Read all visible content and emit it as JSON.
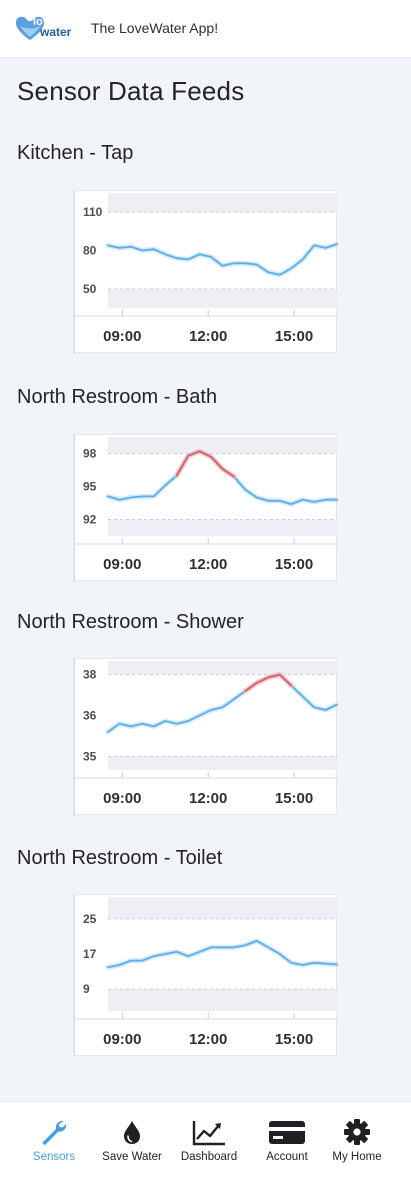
{
  "header": {
    "logo_text_line1": "love",
    "logo_text_line2": "water",
    "app_title": "The LoveWater App!"
  },
  "page_title": "Sensor Data Feeds",
  "colors": {
    "accent": "#4a9be8",
    "line": "#5aaee8",
    "alert_line": "#e05a63",
    "band": "#eeeef4"
  },
  "sensors": [
    {
      "title": "Kitchen - Tap",
      "chart_data": {
        "type": "line",
        "x_ticks": [
          "09:00",
          "12:00",
          "15:00"
        ],
        "y_ticks": [
          "110",
          "80",
          "50"
        ],
        "ylim": [
          35,
          125
        ],
        "normal_band": [
          50,
          110
        ],
        "x": [
          8.5,
          8.9,
          9.3,
          9.7,
          10.1,
          10.5,
          10.9,
          11.3,
          11.7,
          12.1,
          12.5,
          12.9,
          13.3,
          13.7,
          14.1,
          14.5,
          14.9,
          15.3,
          15.7,
          16.1,
          16.5
        ],
        "values": [
          84,
          82,
          83,
          80,
          81,
          77,
          74,
          73,
          77,
          75,
          68,
          70,
          70,
          69,
          63,
          61,
          66,
          73,
          84,
          82,
          85
        ],
        "alert_segments": []
      }
    },
    {
      "title": "North Restroom - Bath",
      "chart_data": {
        "type": "line",
        "x_ticks": [
          "09:00",
          "12:00",
          "15:00"
        ],
        "y_ticks": [
          "98",
          "95",
          "92"
        ],
        "ylim": [
          90.5,
          99.5
        ],
        "normal_band": [
          92,
          98
        ],
        "x": [
          8.5,
          8.9,
          9.3,
          9.7,
          10.1,
          10.5,
          10.9,
          11.3,
          11.7,
          12.1,
          12.5,
          12.9,
          13.3,
          13.7,
          14.1,
          14.5,
          14.9,
          15.3,
          15.7,
          16.1,
          16.5
        ],
        "values": [
          94.1,
          93.8,
          94.0,
          94.1,
          94.1,
          95.1,
          96.0,
          97.8,
          98.2,
          97.7,
          96.6,
          95.9,
          94.7,
          94.0,
          93.7,
          93.7,
          93.4,
          93.8,
          93.6,
          93.8,
          93.8
        ],
        "alert_segments": [
          [
            6,
            11
          ]
        ]
      }
    },
    {
      "title": "North Restroom - Shower",
      "chart_data": {
        "type": "line",
        "x_ticks": [
          "09:00",
          "12:00",
          "15:00"
        ],
        "y_ticks": [
          "38",
          "36",
          "35"
        ],
        "ylim": [
          34.5,
          38.5
        ],
        "normal_band": [
          35,
          38
        ],
        "x": [
          8.5,
          8.9,
          9.3,
          9.7,
          10.1,
          10.5,
          10.9,
          11.3,
          11.7,
          12.1,
          12.5,
          12.9,
          13.3,
          13.7,
          14.1,
          14.5,
          14.9,
          15.3,
          15.7,
          16.1,
          16.5
        ],
        "values": [
          35.9,
          36.2,
          36.1,
          36.2,
          36.1,
          36.3,
          36.2,
          36.3,
          36.5,
          36.7,
          36.8,
          37.1,
          37.4,
          37.7,
          37.9,
          38.0,
          37.6,
          37.2,
          36.8,
          36.7,
          36.9
        ],
        "alert_segments": [
          [
            12,
            16
          ]
        ]
      }
    },
    {
      "title": "North Restroom - Toilet",
      "chart_data": {
        "type": "line",
        "x_ticks": [
          "09:00",
          "12:00",
          "15:00"
        ],
        "y_ticks": [
          "25",
          "17",
          "9"
        ],
        "ylim": [
          4,
          30
        ],
        "normal_band": [
          9,
          25
        ],
        "x": [
          8.5,
          8.9,
          9.3,
          9.7,
          10.1,
          10.5,
          10.9,
          11.3,
          11.7,
          12.1,
          12.5,
          12.9,
          13.3,
          13.7,
          14.1,
          14.5,
          14.9,
          15.3,
          15.7,
          16.1,
          16.5
        ],
        "values": [
          14,
          14.5,
          15.5,
          15.5,
          16.5,
          17,
          17.5,
          16.5,
          17.5,
          18.5,
          18.5,
          18.5,
          19,
          20,
          18.5,
          17,
          15,
          14.5,
          15,
          14.8,
          14.6
        ],
        "alert_segments": []
      }
    }
  ],
  "bottom_nav": [
    {
      "label": "Sensors",
      "icon": "wrench-icon",
      "active": true
    },
    {
      "label": "Save Water",
      "icon": "water-drop-icon",
      "active": false
    },
    {
      "label": "Dashboard",
      "icon": "line-chart-icon",
      "active": false
    },
    {
      "label": "Account",
      "icon": "credit-card-icon",
      "active": false
    },
    {
      "label": "My Home",
      "icon": "gear-icon",
      "active": false
    }
  ]
}
